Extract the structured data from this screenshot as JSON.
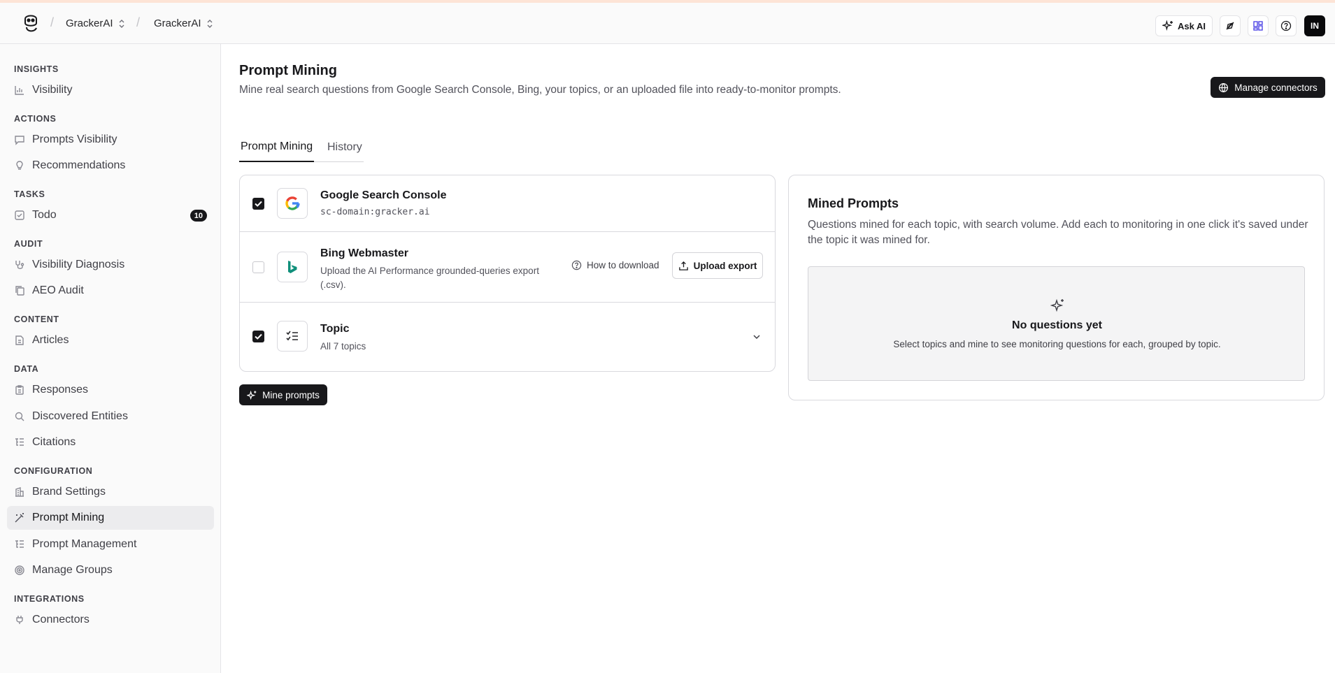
{
  "topbar": {
    "crumbs": [
      "GrackerAI",
      "GrackerAI"
    ],
    "ask_ai": "Ask AI",
    "avatar": "IN"
  },
  "sidebar": {
    "sections": {
      "insights": "INSIGHTS",
      "actions": "ACTIONS",
      "tasks": "TASKS",
      "audit": "AUDIT",
      "content": "CONTENT",
      "data": "DATA",
      "configuration": "CONFIGURATION",
      "integrations": "INTEGRATIONS"
    },
    "items": {
      "visibility": "Visibility",
      "prompts_visibility": "Prompts Visibility",
      "recommendations": "Recommendations",
      "todo": "Todo",
      "todo_count": "10",
      "visibility_diagnosis": "Visibility Diagnosis",
      "aeo_audit": "AEO Audit",
      "articles": "Articles",
      "responses": "Responses",
      "discovered_entities": "Discovered Entities",
      "citations": "Citations",
      "brand_settings": "Brand Settings",
      "prompt_mining": "Prompt Mining",
      "prompt_management": "Prompt Management",
      "manage_groups": "Manage Groups",
      "connectors": "Connectors"
    }
  },
  "main": {
    "title": "Prompt Mining",
    "subtitle": "Mine real search questions from Google Search Console, Bing, your topics, or an uploaded file into ready-to-monitor prompts.",
    "manage_connectors": "Manage connectors",
    "tabs": [
      "Prompt Mining",
      "History"
    ],
    "sources": {
      "gsc": {
        "name": "Google Search Console",
        "meta": "sc-domain:gracker.ai",
        "checked": true
      },
      "bing": {
        "name": "Bing Webmaster",
        "meta": "Upload the AI Performance grounded-queries export (.csv).",
        "checked": false,
        "how_to": "How to download",
        "upload": "Upload export"
      },
      "topic": {
        "name": "Topic",
        "meta": "All 7 topics",
        "checked": true
      }
    },
    "mine_button": "Mine prompts"
  },
  "mined": {
    "title": "Mined Prompts",
    "description": "Questions mined for each topic, with search volume. Add each to monitoring in one click it's saved under the topic it was mined for.",
    "empty_title": "No questions yet",
    "empty_sub": "Select topics and mine to see monitoring questions for each, grouped by topic."
  }
}
